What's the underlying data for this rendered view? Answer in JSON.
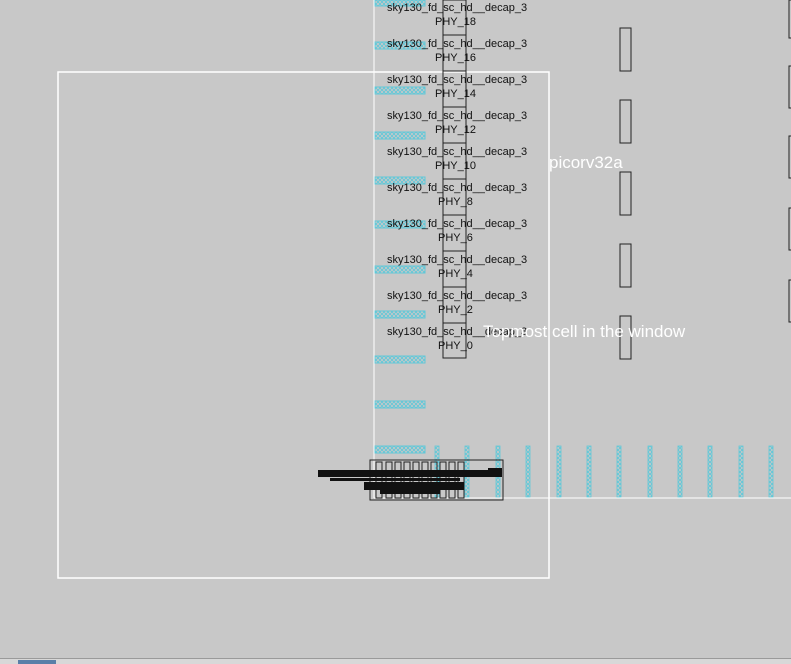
{
  "window": {
    "title": "picorv32a",
    "callout": "Topmost cell in the window"
  },
  "decap_cells": [
    {
      "cell": "sky130_fd_sc_hd__decap_3",
      "instance": "PHY_18"
    },
    {
      "cell": "sky130_fd_sc_hd__decap_3",
      "instance": "PHY_16"
    },
    {
      "cell": "sky130_fd_sc_hd__decap_3",
      "instance": "PHY_14"
    },
    {
      "cell": "sky130_fd_sc_hd__decap_3",
      "instance": "PHY_12"
    },
    {
      "cell": "sky130_fd_sc_hd__decap_3",
      "instance": "PHY_10"
    },
    {
      "cell": "sky130_fd_sc_hd__decap_3",
      "instance": "PHY_8"
    },
    {
      "cell": "sky130_fd_sc_hd__decap_3",
      "instance": "PHY_6"
    },
    {
      "cell": "sky130_fd_sc_hd__decap_3",
      "instance": "PHY_4"
    },
    {
      "cell": "sky130_fd_sc_hd__decap_3",
      "instance": "PHY_2"
    },
    {
      "cell": "sky130_fd_sc_hd__decap_3",
      "instance": "PHY_0"
    }
  ],
  "colors": {
    "background": "#c8c8c8",
    "box": "#ffffff",
    "tap_cell": "#5fc8d8",
    "outline": "#222222"
  }
}
